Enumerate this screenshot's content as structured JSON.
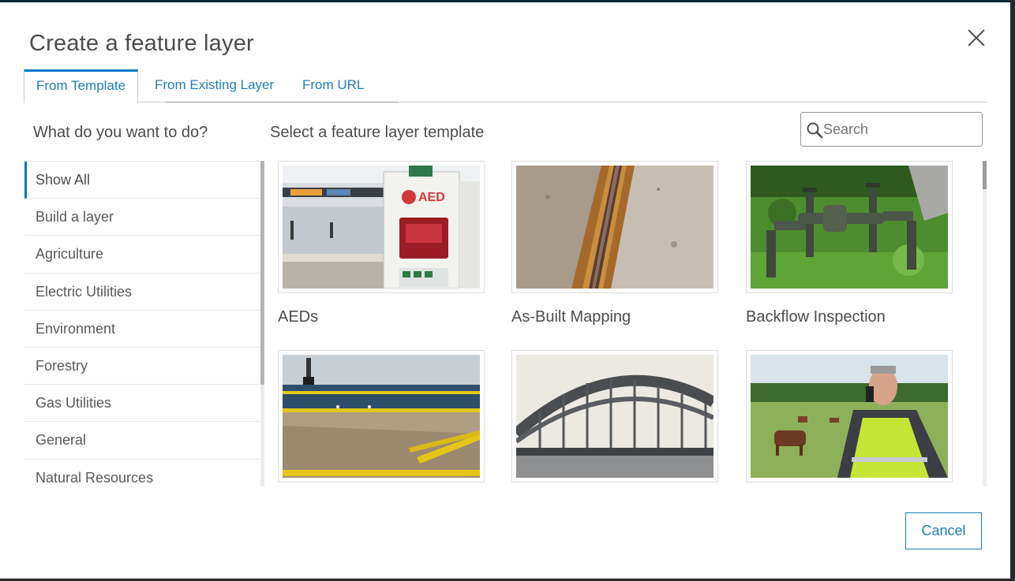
{
  "dialog": {
    "title": "Create a feature layer",
    "close_icon": "close-icon"
  },
  "tabs": [
    {
      "label": "From Template",
      "active": true
    },
    {
      "label": "From Existing Layer",
      "active": false
    },
    {
      "label": "From URL",
      "active": false
    }
  ],
  "left_heading": "What do you want to do?",
  "main_heading": "Select a feature layer template",
  "search": {
    "placeholder": "Search",
    "value": "",
    "icon": "search-icon"
  },
  "categories": [
    {
      "label": "Show All",
      "active": true
    },
    {
      "label": "Build a layer",
      "active": false
    },
    {
      "label": "Agriculture",
      "active": false
    },
    {
      "label": "Electric Utilities",
      "active": false
    },
    {
      "label": "Environment",
      "active": false
    },
    {
      "label": "Forestry",
      "active": false
    },
    {
      "label": "Gas Utilities",
      "active": false
    },
    {
      "label": "General",
      "active": false
    },
    {
      "label": "Natural Resources",
      "active": false
    }
  ],
  "templates": [
    {
      "label": "AEDs",
      "image": "aed-station-photo"
    },
    {
      "label": "As-Built Mapping",
      "image": "pipe-trench-photo"
    },
    {
      "label": "Backflow Inspection",
      "image": "backflow-valve-photo"
    },
    {
      "label": "",
      "image": "oil-boom-beach-photo"
    },
    {
      "label": "",
      "image": "arch-bridge-photo"
    },
    {
      "label": "",
      "image": "field-worker-cattle-photo"
    }
  ],
  "thumb_text": {
    "aed_sign": "AED"
  },
  "footer": {
    "cancel_label": "Cancel"
  },
  "colors": {
    "accent": "#0079c1",
    "link": "#1d7db8"
  }
}
